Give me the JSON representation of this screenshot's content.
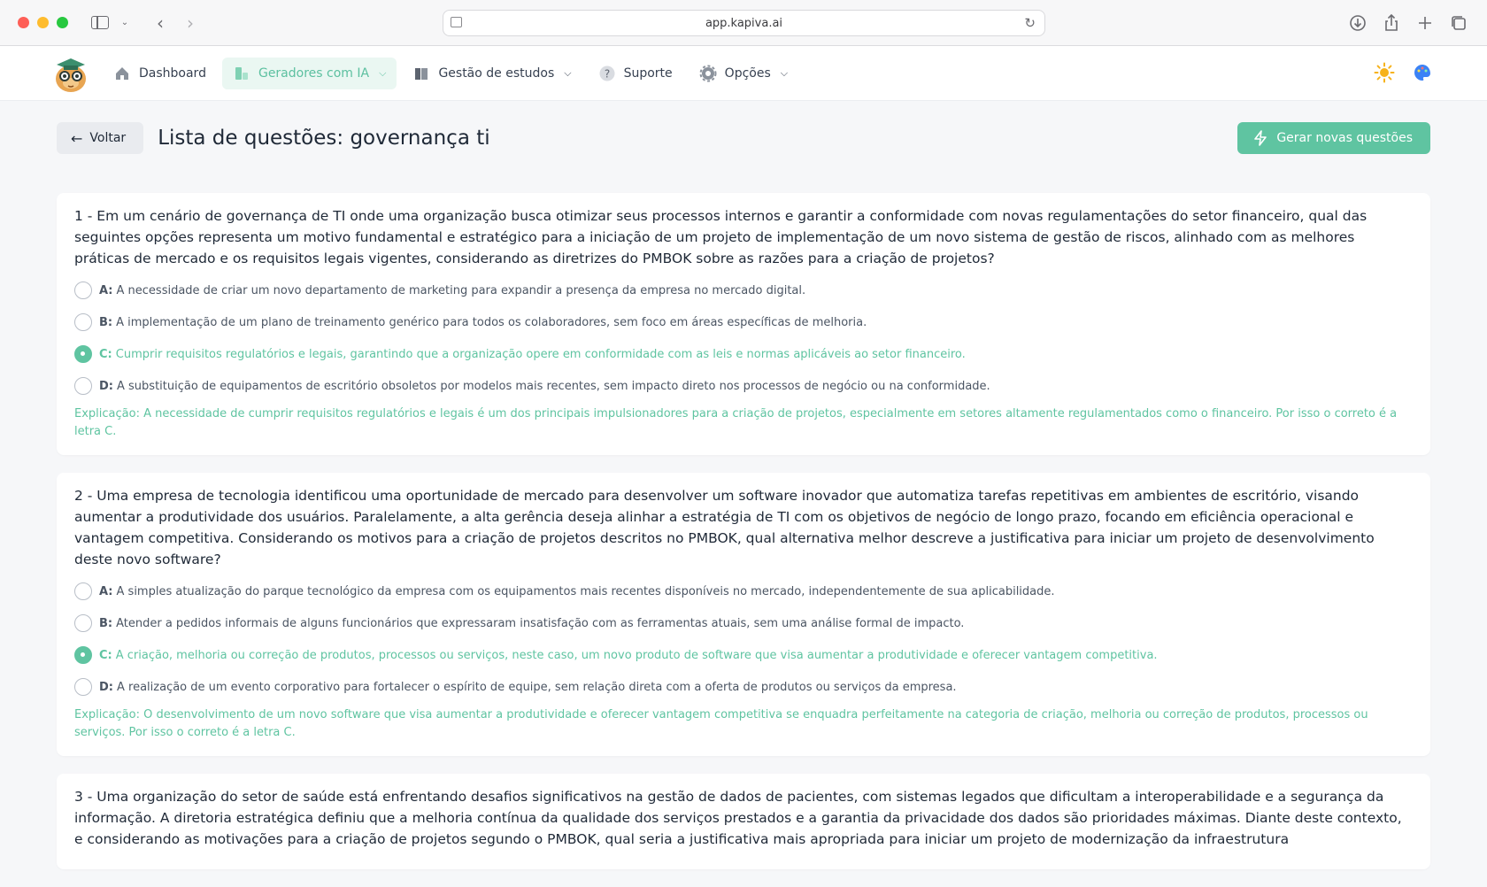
{
  "browser": {
    "url": "app.kapiva.ai"
  },
  "nav": {
    "items": [
      {
        "label": "Dashboard"
      },
      {
        "label": "Geradores com IA"
      },
      {
        "label": "Gestão de estudos"
      },
      {
        "label": "Suporte"
      },
      {
        "label": "Opções"
      }
    ]
  },
  "header": {
    "back_label": "Voltar",
    "title": "Lista de questões: governança ti",
    "generate_label": "Gerar novas questões"
  },
  "colors": {
    "accent": "#5fc4a1",
    "accent_bg": "#eaf7f2"
  },
  "questions": [
    {
      "text": "1 - Em um cenário de governança de TI onde uma organização busca otimizar seus processos internos e garantir a conformidade com novas regulamentações do setor financeiro, qual das seguintes opções representa um motivo fundamental e estratégico para a iniciação de um projeto de implementação de um novo sistema de gestão de riscos, alinhado com as melhores práticas de mercado e os requisitos legais vigentes, considerando as diretrizes do PMBOK sobre as razões para a criação de projetos?",
      "options": [
        {
          "letter": "A:",
          "text": "A necessidade de criar um novo departamento de marketing para expandir a presença da empresa no mercado digital."
        },
        {
          "letter": "B:",
          "text": "A implementação de um plano de treinamento genérico para todos os colaboradores, sem foco em áreas específicas de melhoria."
        },
        {
          "letter": "C:",
          "text": "Cumprir requisitos regulatórios e legais, garantindo que a organização opere em conformidade com as leis e normas aplicáveis ao setor financeiro."
        },
        {
          "letter": "D:",
          "text": "A substituição de equipamentos de escritório obsoletos por modelos mais recentes, sem impacto direto nos processos de negócio ou na conformidade."
        }
      ],
      "explanation": "Explicação: A necessidade de cumprir requisitos regulatórios e legais é um dos principais impulsionadores para a criação de projetos, especialmente em setores altamente regulamentados como o financeiro. Por isso o correto é a letra C."
    },
    {
      "text": "2 - Uma empresa de tecnologia identificou uma oportunidade de mercado para desenvolver um software inovador que automatiza tarefas repetitivas em ambientes de escritório, visando aumentar a produtividade dos usuários. Paralelamente, a alta gerência deseja alinhar a estratégia de TI com os objetivos de negócio de longo prazo, focando em eficiência operacional e vantagem competitiva. Considerando os motivos para a criação de projetos descritos no PMBOK, qual alternativa melhor descreve a justificativa para iniciar um projeto de desenvolvimento deste novo software?",
      "options": [
        {
          "letter": "A:",
          "text": "A simples atualização do parque tecnológico da empresa com os equipamentos mais recentes disponíveis no mercado, independentemente de sua aplicabilidade."
        },
        {
          "letter": "B:",
          "text": "Atender a pedidos informais de alguns funcionários que expressaram insatisfação com as ferramentas atuais, sem uma análise formal de impacto."
        },
        {
          "letter": "C:",
          "text": "A criação, melhoria ou correção de produtos, processos ou serviços, neste caso, um novo produto de software que visa aumentar a produtividade e oferecer vantagem competitiva."
        },
        {
          "letter": "D:",
          "text": "A realização de um evento corporativo para fortalecer o espírito de equipe, sem relação direta com a oferta de produtos ou serviços da empresa."
        }
      ],
      "explanation": "Explicação: O desenvolvimento de um novo software que visa aumentar a produtividade e oferecer vantagem competitiva se enquadra perfeitamente na categoria de criação, melhoria ou correção de produtos, processos ou serviços. Por isso o correto é a letra C."
    },
    {
      "text": "3 - Uma organização do setor de saúde está enfrentando desafios significativos na gestão de dados de pacientes, com sistemas legados que dificultam a interoperabilidade e a segurança da informação. A diretoria estratégica definiu que a melhoria contínua da qualidade dos serviços prestados e a garantia da privacidade dos dados são prioridades máximas. Diante deste contexto, e considerando as motivações para a criação de projetos segundo o PMBOK, qual seria a justificativa mais apropriada para iniciar um projeto de modernização da infraestrutura"
    }
  ]
}
